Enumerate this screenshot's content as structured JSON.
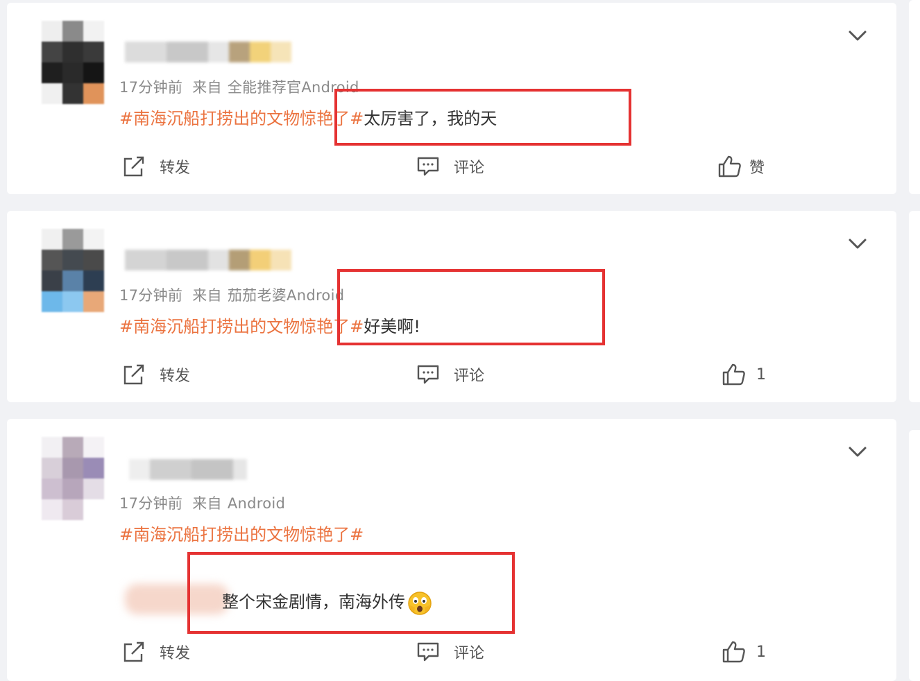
{
  "posts": [
    {
      "time": "17分钟前",
      "source_label": "来自",
      "source": "全能推荐官Android",
      "topic": "#南海沉船打捞出的文物惊艳了#",
      "text": "太厉害了，我的天",
      "reply_text": "",
      "actions": {
        "repost": "转发",
        "comment": "评论",
        "like": "赞"
      }
    },
    {
      "time": "17分钟前",
      "source_label": "来自",
      "source": "茄茄老婆Android",
      "topic": "#南海沉船打捞出的文物惊艳了#",
      "text": "好美啊!",
      "reply_text": "",
      "actions": {
        "repost": "转发",
        "comment": "评论",
        "like": "1"
      }
    },
    {
      "time": "17分钟前",
      "source_label": "来自",
      "source": "Android",
      "topic": "#南海沉船打捞出的文物惊艳了#",
      "text": "",
      "reply_text": "整个宋金剧情，南海外传",
      "actions": {
        "repost": "转发",
        "comment": "评论",
        "like": "1"
      }
    }
  ],
  "icons": {
    "repost": "repost-icon",
    "comment": "comment-icon",
    "like": "thumbs-up-icon",
    "menu": "chevron-down-icon",
    "emoji": "shocked-face-emoji-icon"
  },
  "colors": {
    "topic": "#eb7340",
    "highlight_box": "#e53232",
    "meta_text": "#8a8a8a",
    "page_bg": "#f1f2f5"
  }
}
